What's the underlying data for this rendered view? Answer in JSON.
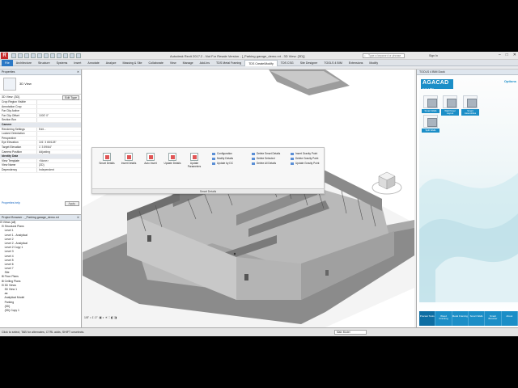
{
  "app": {
    "logo": "R",
    "title": "Autodesk Revit 2017.2 - Not For Resale Version - [_Parking garage_demo.rvt - 3D View: {3D}]",
    "search_placeholder": "Type a keyword or phrase",
    "sign_in": "Sign In",
    "window_controls": [
      "–",
      "□",
      "✕"
    ]
  },
  "ribbon": {
    "file_tab": "File",
    "tabs": [
      "Architecture",
      "Structure",
      "Systems",
      "Insert",
      "Annotate",
      "Analyze",
      "Massing & Site",
      "Collaborate",
      "View",
      "Manage",
      "Add-Ins",
      "TDS Metal Framing",
      "TDS Create/Modify",
      "TDS CSG",
      "Site Designer",
      "TOOLS 4 BIM",
      "Extensions",
      "Modify"
    ],
    "active_tab": "TDS Create/Modify"
  },
  "properties": {
    "header": "Properties",
    "type_name": "3D View",
    "type_row": "3D View: {3D}",
    "edit_type": "Edit Type",
    "rows": [
      {
        "k": "Crop Region Visible",
        "v": ""
      },
      {
        "k": "Annotation Crop",
        "v": ""
      },
      {
        "k": "Far Clip Active",
        "v": ""
      },
      {
        "k": "Far Clip Offset",
        "v": "1000' 0\""
      },
      {
        "k": "Section Box",
        "v": ""
      },
      {
        "k": "Camera",
        "v": "",
        "group": true
      },
      {
        "k": "Rendering Settings",
        "v": "Edit..."
      },
      {
        "k": "Locked Orientation",
        "v": ""
      },
      {
        "k": "Perspective",
        "v": ""
      },
      {
        "k": "Eye Elevation",
        "v": "101' 3 65/128\""
      },
      {
        "k": "Target Elevation",
        "v": "1' 3 59/64\""
      },
      {
        "k": "Camera Position",
        "v": "Adjusting"
      },
      {
        "k": "Identity Data",
        "v": "",
        "group": true
      },
      {
        "k": "View Template",
        "v": "<None>"
      },
      {
        "k": "View Name",
        "v": "{3D}"
      },
      {
        "k": "Dependency",
        "v": "Independent"
      }
    ],
    "help_link": "Properties help",
    "apply": "Apply"
  },
  "browser": {
    "header": "Project Browser - _Parking garage_demo.rvt",
    "items": [
      "⊟ Views (all)",
      "  ⊟ Structural Plans",
      "      Level 1",
      "      Level 1 - Analytical",
      "      Level 2",
      "      Level 2 - Analytical",
      "      Level 2 Copy 1",
      "      Level 3",
      "      Level 4",
      "      Level 5",
      "      Level 6",
      "      Level 7",
      "      Site",
      "  ⊞ Floor Plans",
      "  ⊞ Ceiling Plans",
      "  ⊟ 3D Views",
      "      3D View 1",
      "      aa",
      "      Analytical Model",
      "      Parking",
      "      {3D}",
      "      {3D} Copy 1"
    ]
  },
  "status": {
    "text": "Click to select, TAB for alternates, CTRL adds, SHIFT unselects.",
    "model": "Main Model"
  },
  "smart_details": {
    "big_buttons": [
      "Smart Details",
      "Insert Details",
      "Auto Insert",
      "Update Details",
      "Update Parameters"
    ],
    "col1": [
      "Configuration",
      "Modify Details",
      "Update by DC"
    ],
    "col2": [
      "Delete Smart Details",
      "Delete Selected",
      "Delete All Details"
    ],
    "col3": [
      "Insert Gravity Point",
      "Delete Gravity Point",
      "Update Gravity Point"
    ],
    "caption": "Smart Details"
  },
  "viewport": {
    "scale": "1/8\" = 1'-0\"",
    "viewcube_face": "FRONT"
  },
  "dock": {
    "header": "TOOLS 4 BIM Dock",
    "logo": "AGACAD",
    "logo_sub": "Tools 4 BIM",
    "options": "Options",
    "tools": [
      "Smart Walls",
      "Wall Panel Layout",
      "Smart Assemblies",
      "Split Walls"
    ],
    "tabs": [
      "Precast Tools",
      "Wood Framing",
      "Metal Framing",
      "Smart Walls",
      "Smart Browser",
      "About"
    ],
    "active_tab": "Precast Tools"
  }
}
